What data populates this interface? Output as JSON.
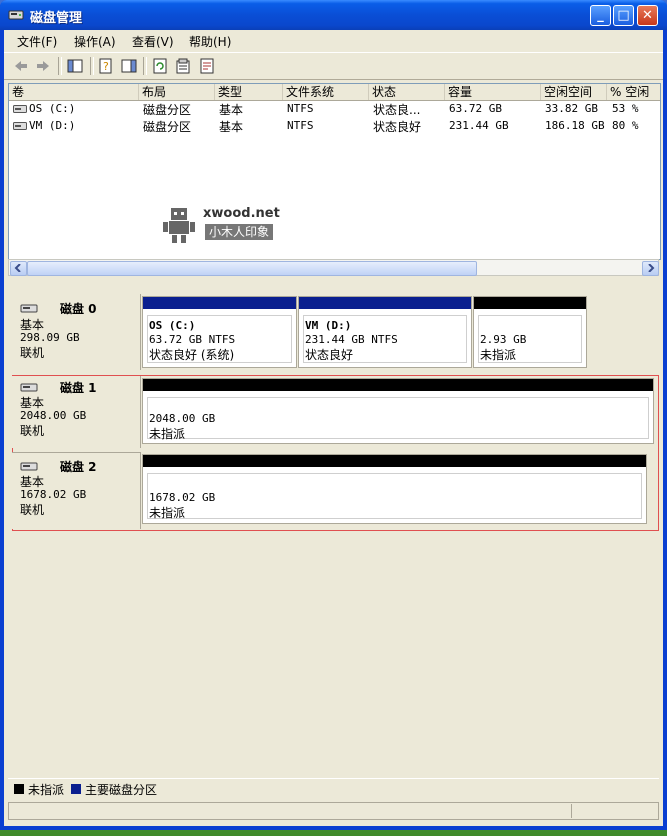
{
  "window": {
    "title": "磁盘管理"
  },
  "menu": [
    {
      "label": "文件(F)"
    },
    {
      "label": "操作(A)"
    },
    {
      "label": "查看(V)"
    },
    {
      "label": "帮助(H)"
    }
  ],
  "list": {
    "headers": [
      "卷",
      "布局",
      "类型",
      "文件系统",
      "状态",
      "容量",
      "空闲空间",
      "% 空闲"
    ],
    "rows": [
      {
        "vol": "OS (C:)",
        "layout": "磁盘分区",
        "type": "基本",
        "fs": "NTFS",
        "status": "状态良...",
        "cap": "63.72 GB",
        "free": "33.82 GB",
        "pct": "53 %"
      },
      {
        "vol": "VM (D:)",
        "layout": "磁盘分区",
        "type": "基本",
        "fs": "NTFS",
        "status": "状态良好",
        "cap": "231.44 GB",
        "free": "186.18 GB",
        "pct": "80 %"
      }
    ]
  },
  "watermark": {
    "brand": "xwood.net",
    "sub": "小木人印象"
  },
  "disks": [
    {
      "name": "磁盘 0",
      "type": "基本",
      "size": "298.09 GB",
      "state": "联机",
      "parts": [
        {
          "name": "OS  (C:)",
          "line2": "63.72 GB NTFS",
          "line3": "状态良好 (系统)",
          "color": "#0a1f8f"
        },
        {
          "name": "VM  (D:)",
          "line2": "231.44 GB NTFS",
          "line3": "状态良好",
          "color": "#0a1f8f"
        },
        {
          "name": "",
          "line2": "2.93 GB",
          "line3": "未指派",
          "color": "#000000"
        }
      ]
    },
    {
      "name": "磁盘 1",
      "type": "基本",
      "size": "2048.00 GB",
      "state": "联机",
      "parts": [
        {
          "name": "",
          "line2": "2048.00 GB",
          "line3": "未指派",
          "color": "#000000"
        }
      ]
    },
    {
      "name": "磁盘 2",
      "type": "基本",
      "size": "1678.02 GB",
      "state": "联机",
      "parts": [
        {
          "name": "",
          "line2": "1678.02 GB",
          "line3": "未指派",
          "color": "#000000"
        }
      ]
    }
  ],
  "legend": [
    {
      "label": "未指派",
      "color": "#000000"
    },
    {
      "label": "主要磁盘分区",
      "color": "#0a1f8f"
    }
  ],
  "colors": {
    "primary_partition": "#0a1f8f",
    "unallocated": "#000000",
    "selection_border": "#e05050"
  }
}
